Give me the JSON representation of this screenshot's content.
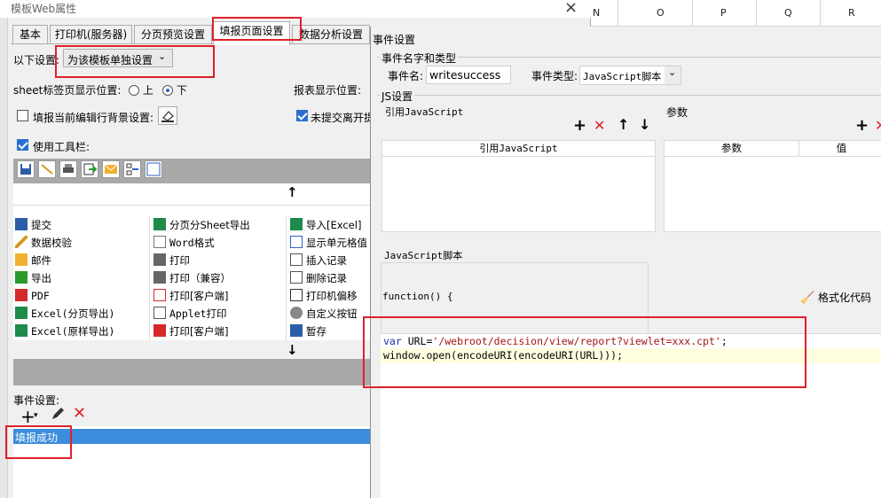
{
  "left_dialog": {
    "title": "模板Web属性",
    "close_glyph": "×",
    "tabs": [
      "基本",
      "打印机(服务器)",
      "分页预览设置",
      "填报页面设置",
      "数据分析设置"
    ],
    "settings_label": "以下设置:",
    "settings_value": "为该模板单独设置",
    "sheet_pos_label": "sheet标签页显示位置:",
    "sheet_pos_top": "上",
    "sheet_pos_bottom": "下",
    "report_pos_label": "报表显示位置:",
    "fill_bg_label": "填报当前编辑行背景设置:",
    "unsubmitted_label": "未提交离开提",
    "use_toolbar_label": "使用工具栏:",
    "up_arrow": "↑",
    "down_arrow": "↓",
    "buttons_col1": [
      "提交",
      "数据校验",
      "邮件",
      "导出",
      "PDF",
      "Excel(分页导出)",
      "Excel(原样导出)"
    ],
    "buttons_col2": [
      "分页分Sheet导出",
      "Word格式",
      "打印",
      "打印（兼容）",
      "打印[客户端]",
      "Applet打印",
      "打印[客户端]"
    ],
    "buttons_col3": [
      "导入[Excel]",
      "显示单元格值",
      "插入记录",
      "删除记录",
      "打印机偏移",
      "自定义按钮",
      "暂存"
    ],
    "event_label": "事件设置:",
    "event_item": "填报成功"
  },
  "right_dialog": {
    "title": "事件设置",
    "section1_title": "事件名字和类型",
    "event_name_label": "事件名:",
    "event_name_value": "writesuccess",
    "event_type_label": "事件类型:",
    "event_type_value": "JavaScript脚本",
    "js_section_title": "JS设置",
    "ref_js_label": "引用JavaScript",
    "params_label": "参数",
    "ref_js_col": "引用JavaScript",
    "params_col": "参数",
    "value_col": "值",
    "js_script_label": "JavaScript脚本",
    "function_header": "function() {",
    "format_code_label": "格式化代码",
    "code_line1_kw": "var",
    "code_line1_rest": " URL=",
    "code_line1_str": "'/webroot/decision/view/report?viewlet=xxx.cpt'",
    "code_line1_end": ";",
    "code_line2": "window.open(encodeURI(encodeURI(URL)));"
  },
  "spreadsheet": {
    "columns": [
      "N",
      "O",
      "P",
      "Q",
      "R"
    ]
  },
  "colors": {
    "highlight_red": "#e0202a",
    "selection_blue": "#3c8ddc",
    "toolbar_gray": "#a9a9a9",
    "code_bg": "#ffffe0"
  }
}
